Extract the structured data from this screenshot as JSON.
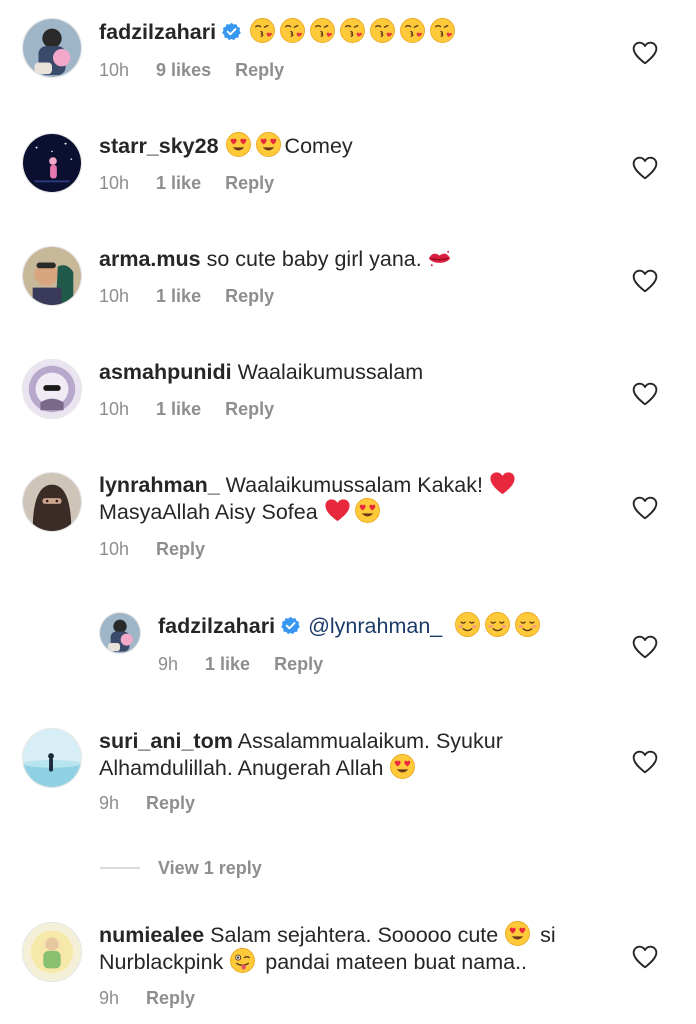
{
  "comments": [
    {
      "user": "fadzilzahari",
      "text": "",
      "time": "10h",
      "likes": "9 likes",
      "reply": "Reply"
    },
    {
      "user": "starr_sky28",
      "text": "Comey",
      "time": "10h",
      "likes": "1 like",
      "reply": "Reply"
    },
    {
      "user": "arma.mus",
      "text": "so cute baby girl yana.",
      "time": "10h",
      "likes": "1 like",
      "reply": "Reply"
    },
    {
      "user": "asmahpunidi",
      "text": "Waalaikumussalam",
      "time": "10h",
      "likes": "1 like",
      "reply": "Reply"
    },
    {
      "user": "lynrahman_",
      "text": "Waalaikumussalam Kakak!",
      "text2": "MasyaAllah Aisy Sofea",
      "time": "10h",
      "reply": "Reply"
    },
    {
      "user": "fadzilzahari",
      "mention": "@lynrahman_",
      "time": "9h",
      "likes": "1 like",
      "reply": "Reply"
    },
    {
      "user": "suri_ani_tom",
      "text": "Assalammualaikum. Syukur",
      "text2": "Alhamdulillah. Anugerah Allah",
      "time": "9h",
      "reply": "Reply"
    },
    {
      "user": "numiealee",
      "text": "Salam sejahtera. Sooooo cute",
      "text_after": "si",
      "text2": "Nurblackpink",
      "text2_after": "pandai mateen buat nama..",
      "time": "9h",
      "reply": "Reply"
    }
  ],
  "view_replies": "View 1 reply",
  "icons": {
    "heart": "heart-outline-icon",
    "verified": "verified-badge-icon",
    "emoji_kiss": "face-blowing-kiss-emoji",
    "emoji_heart_eyes": "heart-eyes-emoji",
    "emoji_lips": "kiss-mark-emoji",
    "emoji_red_heart": "red-heart-emoji",
    "emoji_smiling": "smiling-face-emoji",
    "emoji_wink_tongue": "winking-face-tongue-emoji"
  },
  "colors": {
    "text": "#262626",
    "meta": "#8e8e8e",
    "mention": "#1c3b6b",
    "verified": "#3897f0"
  }
}
